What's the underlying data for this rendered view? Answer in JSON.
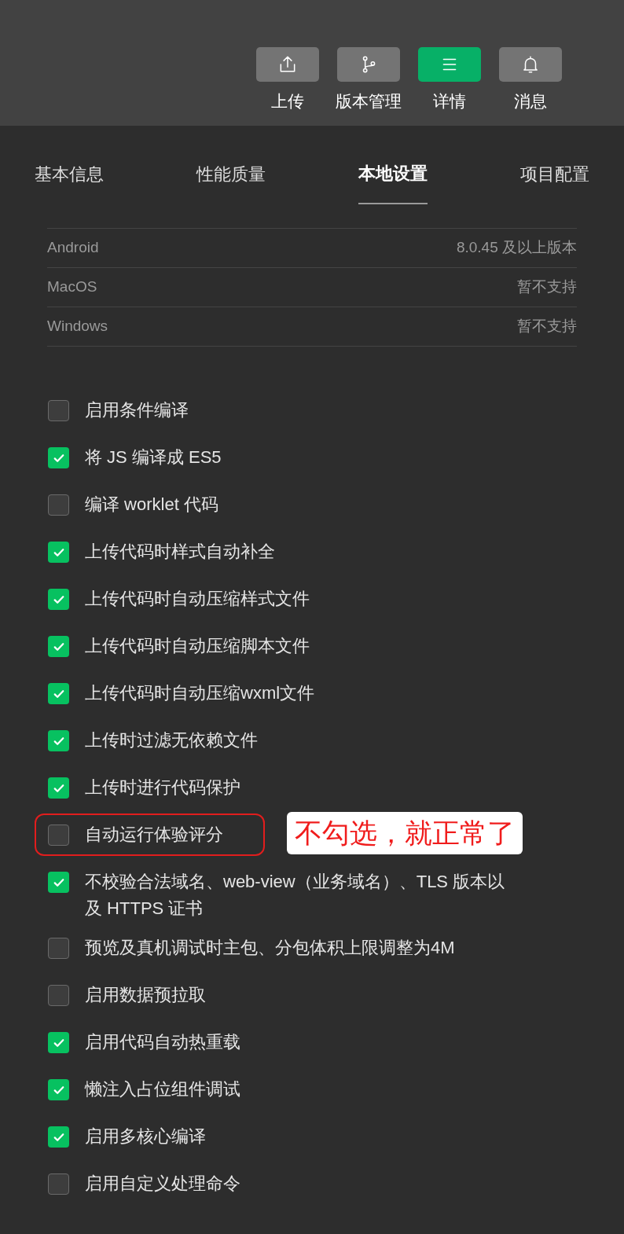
{
  "toolbar": [
    {
      "label": "上传",
      "selected": false
    },
    {
      "label": "版本管理",
      "selected": false
    },
    {
      "label": "详情",
      "selected": true
    },
    {
      "label": "消息",
      "selected": false
    }
  ],
  "tabs": [
    {
      "label": "基本信息",
      "selected": false
    },
    {
      "label": "性能质量",
      "selected": false
    },
    {
      "label": "本地设置",
      "selected": true
    },
    {
      "label": "项目配置",
      "selected": false
    }
  ],
  "versions": [
    {
      "platform": "Android",
      "value": "8.0.45 及以上版本"
    },
    {
      "platform": "MacOS",
      "value": "暂不支持"
    },
    {
      "platform": "Windows",
      "value": "暂不支持"
    }
  ],
  "options": [
    {
      "label": "启用条件编译",
      "checked": false
    },
    {
      "label": "将 JS 编译成 ES5",
      "checked": true
    },
    {
      "label": "编译 worklet 代码",
      "checked": false
    },
    {
      "label": "上传代码时样式自动补全",
      "checked": true
    },
    {
      "label": "上传代码时自动压缩样式文件",
      "checked": true
    },
    {
      "label": "上传代码时自动压缩脚本文件",
      "checked": true
    },
    {
      "label": "上传代码时自动压缩wxml文件",
      "checked": true
    },
    {
      "label": "上传时过滤无依赖文件",
      "checked": true
    },
    {
      "label": "上传时进行代码保护",
      "checked": true
    },
    {
      "label": "自动运行体验评分",
      "checked": false,
      "highlighted": true,
      "callout": "不勾选，就正常了"
    },
    {
      "label": "不校验合法域名、web-view（业务域名）、TLS 版本以及 HTTPS 证书",
      "checked": true
    },
    {
      "label": "预览及真机调试时主包、分包体积上限调整为4M",
      "checked": false
    },
    {
      "label": "启用数据预拉取",
      "checked": false
    },
    {
      "label": "启用代码自动热重载",
      "checked": true
    },
    {
      "label": "懒注入占位组件调试",
      "checked": true
    },
    {
      "label": "启用多核心编译",
      "checked": true
    },
    {
      "label": "启用自定义处理命令",
      "checked": false
    }
  ]
}
